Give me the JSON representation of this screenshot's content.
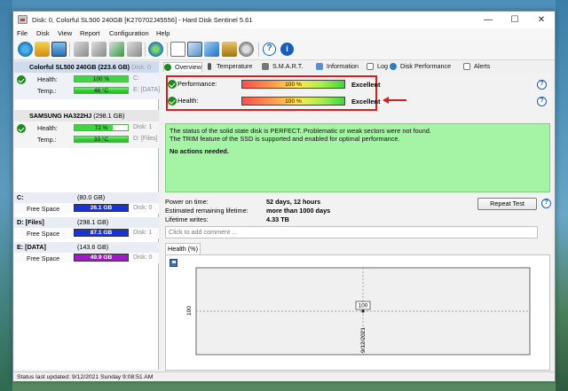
{
  "window": {
    "title": "Disk: 0, Colorful SL500 240GB [K270702J45556]  -  Hard Disk Sentinel 5.61",
    "min_label": "—",
    "max_label": "☐",
    "close_label": "✕"
  },
  "menu": [
    "File",
    "Disk",
    "View",
    "Report",
    "Configuration",
    "Help"
  ],
  "toolbar_icons": [
    "refresh-icon",
    "home-icon",
    "display-icon",
    "disk-check-icon",
    "disk-test-icon",
    "disk-smart-icon",
    "disk-info-icon",
    "globe-icon",
    "document-icon",
    "copy-icon",
    "send-icon",
    "lock-icon",
    "settings-icon",
    "help-icon",
    "info-icon"
  ],
  "disks": [
    {
      "name": "Colorful SL500 240GB",
      "size": "(223.6 GB)",
      "disk_label": "Disk: 0",
      "health_label": "Health:",
      "health": "100 %",
      "health_fraction": 1.0,
      "temp_label": "Temp.:",
      "temp": "48 °C",
      "side1": "C:",
      "side2": "E: [DATA]"
    },
    {
      "name": "SAMSUNG HA322HJ",
      "size": "(298.1 GB)",
      "disk_label": "",
      "health_label": "Health:",
      "health": "72 %",
      "health_fraction": 0.72,
      "temp_label": "Temp.:",
      "temp": "33 °C",
      "side1": "Disk: 1",
      "side2": "D: [Files]"
    }
  ],
  "volumes": [
    {
      "letter": "C:",
      "size": "(80.0 GB)",
      "fs_label": "Free Space",
      "free": "26.1 GB",
      "disk": "Disk: 0",
      "color": "#1a33d6",
      "fill": 0.33
    },
    {
      "letter": "D: [Files]",
      "size": "(298.1 GB)",
      "fs_label": "Free Space",
      "free": "87.1 GB",
      "disk": "Disk: 1",
      "color": "#1a33d6",
      "fill": 0.29
    },
    {
      "letter": "E: [DATA]",
      "size": "(143.6 GB)",
      "fs_label": "Free Space",
      "free": "49.9 GB",
      "disk": "Disk: 0",
      "color": "#a01bc7",
      "fill": 0.35
    }
  ],
  "tabs": [
    "Overview",
    "Temperature",
    "S.M.A.R.T.",
    "Information",
    "Log",
    "Disk Performance",
    "Alerts"
  ],
  "metrics": {
    "performance_label": "Performance:",
    "performance": "100 %",
    "performance_rating": "Excellent",
    "health_label": "Health:",
    "health": "100 %",
    "health_rating": "Excellent",
    "help_glyph": "?"
  },
  "status_lines": [
    "The status of the solid state disk is PERFECT. Problematic or weak sectors were not found.",
    "The TRIM feature of the SSD is supported and enabled for optimal performance."
  ],
  "status_action": "No actions needed.",
  "info": {
    "power_on_label": "Power on time:",
    "power_on": "52 days, 12 hours",
    "remaining_label": "Estimated remaining lifetime:",
    "remaining": "more than 1000 days",
    "writes_label": "Lifetime writes:",
    "writes": "4.33 TB",
    "repeat_button": "Repeat Test",
    "comment_placeholder": "Click to add comment ..."
  },
  "chart_tab": "Health (%)",
  "chart_data": {
    "type": "line",
    "title": "",
    "xlabel": "",
    "ylabel": "",
    "ytick": "100",
    "points": [
      {
        "x": "9/12/2021",
        "y": 100,
        "label": "100"
      }
    ],
    "ylim": [
      0,
      200
    ]
  },
  "statusbar": "Status last updated: 9/12/2021 Sunday 9:08:51 AM"
}
